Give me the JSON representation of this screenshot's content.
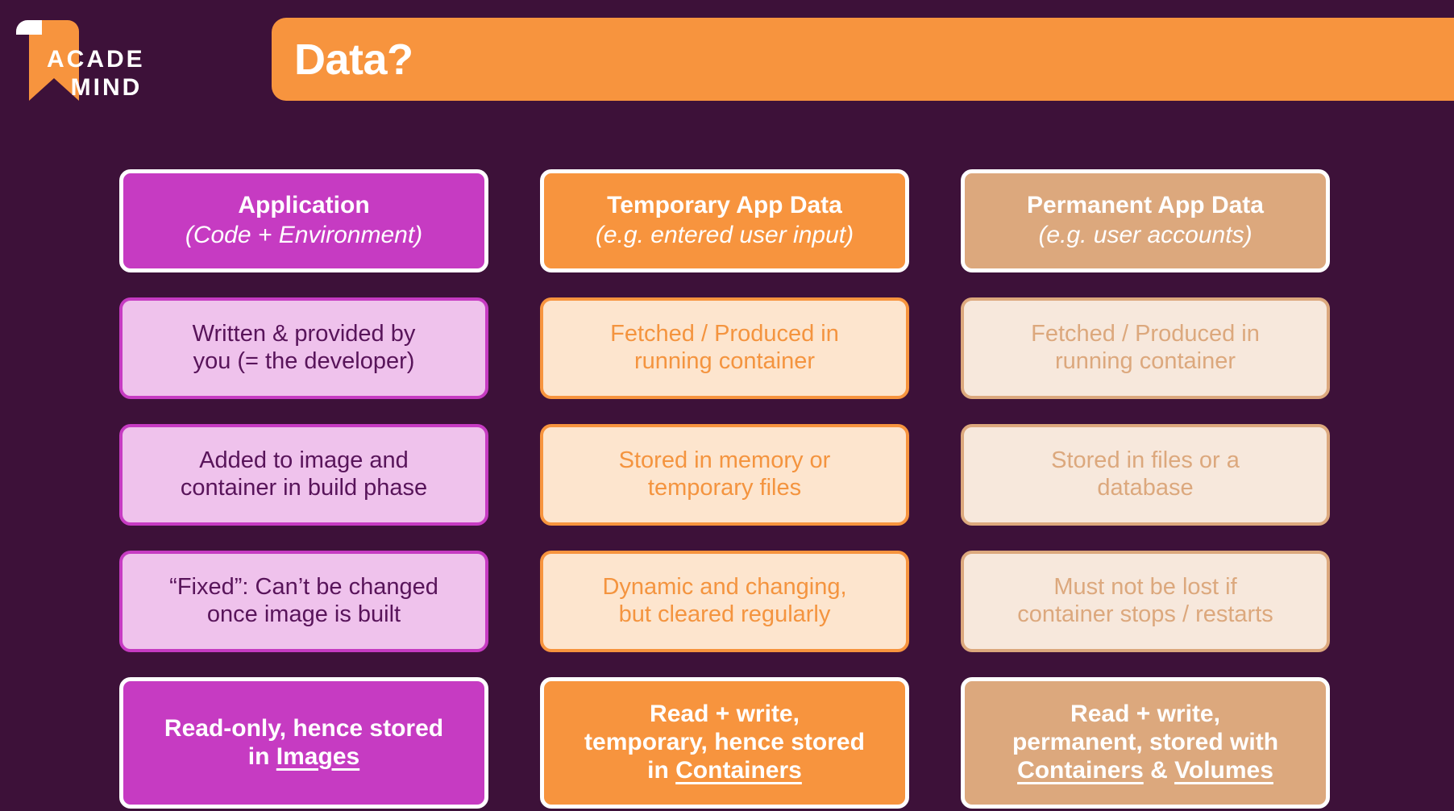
{
  "brand": {
    "logo_line1": "ACADE",
    "logo_line2": "MIND",
    "logo_icon": "bookmark-flag-icon"
  },
  "header": {
    "title": "Data?"
  },
  "colors": {
    "background": "#3D1139",
    "magenta": "#C63BC2",
    "magenta_light": "#EFC2EC",
    "magenta_text": "#58145A",
    "orange": "#F7943E",
    "orange_light": "#FDE5CE",
    "tan": "#DCA87D",
    "tan_light": "#F7E8DC",
    "white": "#FFFFFF"
  },
  "columns": [
    {
      "id": "application",
      "header": {
        "title": "Application",
        "subtitle": "(Code + Environment)"
      },
      "details": [
        {
          "line1": "Written & provided by",
          "line2": "you (= the developer)"
        },
        {
          "line1": "Added to image and",
          "line2": "container in build phase"
        },
        {
          "line1": "“Fixed”: Can’t be changed",
          "line2": "once image is built"
        }
      ],
      "summary": {
        "line1": "Read-only, hence stored",
        "line2_prefix": "in ",
        "line2_link": "Images",
        "line2_suffix": "",
        "line3_prefix": "",
        "line3_link": "",
        "line3_mid": "",
        "line3_link2": ""
      }
    },
    {
      "id": "temporary-app-data",
      "header": {
        "title": "Temporary App Data",
        "subtitle": "(e.g. entered user input)"
      },
      "details": [
        {
          "line1": "Fetched / Produced in",
          "line2": "running container"
        },
        {
          "line1": "Stored in memory or",
          "line2": "temporary files"
        },
        {
          "line1": "Dynamic and changing,",
          "line2": "but cleared regularly"
        }
      ],
      "summary": {
        "line1": "Read + write,",
        "line2_prefix": "temporary, hence stored",
        "line2_link": "",
        "line2_suffix": "",
        "line3_prefix": "in ",
        "line3_link": "Containers",
        "line3_mid": "",
        "line3_link2": ""
      }
    },
    {
      "id": "permanent-app-data",
      "header": {
        "title": "Permanent App Data",
        "subtitle": "(e.g. user accounts)"
      },
      "details": [
        {
          "line1": "Fetched / Produced in",
          "line2": "running container"
        },
        {
          "line1": "Stored in files or a",
          "line2": "database"
        },
        {
          "line1": "Must not be lost if",
          "line2": "container stops / restarts"
        }
      ],
      "summary": {
        "line1": "Read + write,",
        "line2_prefix": "permanent, stored with",
        "line2_link": "",
        "line2_suffix": "",
        "line3_prefix": "",
        "line3_link": "Containers",
        "line3_mid": " & ",
        "line3_link2": "Volumes"
      }
    }
  ]
}
